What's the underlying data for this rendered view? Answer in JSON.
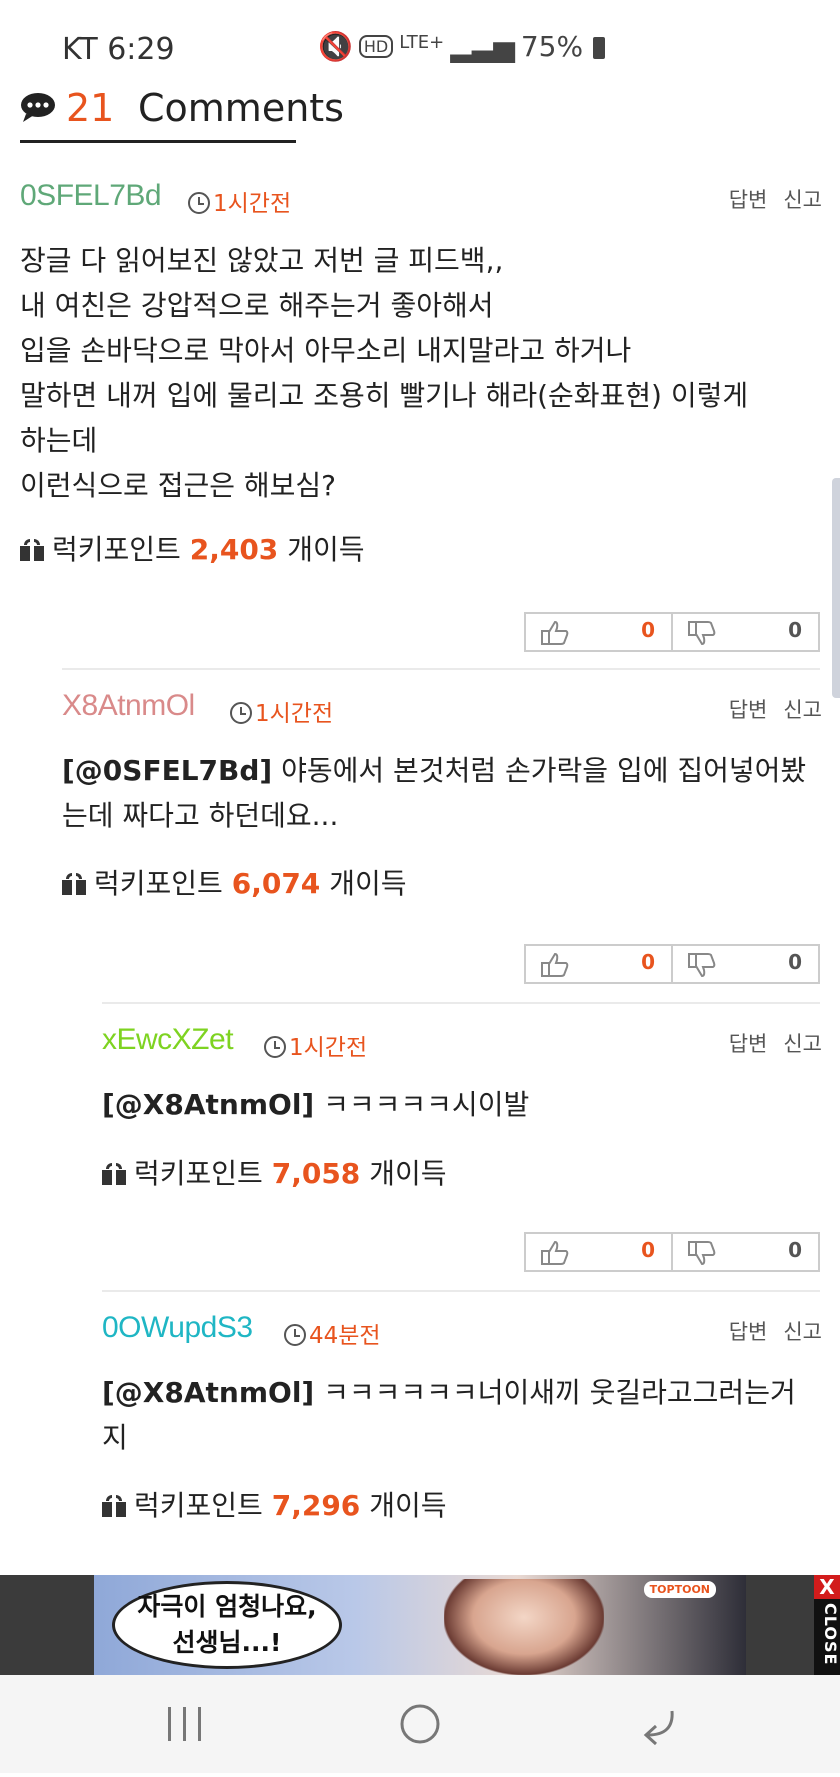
{
  "status_bar": {
    "carrier_time": "KT 6:29",
    "signal_text": "LTE+",
    "battery": "75%"
  },
  "header": {
    "count": "21",
    "label": "Comments"
  },
  "actions": {
    "reply": "답변",
    "report": "신고"
  },
  "lucky_point_label": "럭키포인트",
  "lucky_point_suffix": "개이득",
  "comments": [
    {
      "user": "0SFEL7Bd",
      "user_color": "#5fa878",
      "time": "1시간전",
      "body": "장글 다 읽어보진 않았고 저번 글 피드백,,\n내 여친은 강압적으로 해주는거 좋아해서\n입을 손바닥으로 막아서 아무소리 내지말라고 하거나\n말하면 내꺼 입에 물리고 조용히 빨기나 해라(순화표현) 이렇게\n하는데\n이런식으로 접근은 해보심?",
      "lucky_points": "2,403",
      "likes": "0",
      "dislikes": "0"
    },
    {
      "user": "X8AtnmOl",
      "user_color": "#d98a8a",
      "time": "1시간전",
      "mention": "[@0SFEL7Bd]",
      "body": " 야동에서 본것처럼 손가락을 입에 집어넣어봤\n는데 짜다고 하던데요...",
      "lucky_points": "6,074",
      "likes": "0",
      "dislikes": "0"
    },
    {
      "user": "xEwcXZet",
      "user_color": "#7ed321",
      "time": "1시간전",
      "mention": "[@X8AtnmOl]",
      "body": " ㅋㅋㅋㅋㅋ시이발",
      "lucky_points": "7,058",
      "likes": "0",
      "dislikes": "0"
    },
    {
      "user": "0OWupdS3",
      "user_color": "#1fb6c4",
      "time": "44분전",
      "mention": "[@X8AtnmOl]",
      "body": " ㅋㅋㅋㅋㅋㅋ너이새끼 웃길라고그러는거\n지",
      "lucky_points": "7,296"
    }
  ],
  "ad": {
    "text": "자극이 엄청나요,\n선생님...!",
    "logo": "TOPTOON",
    "close_x": "X",
    "close_label": "CLOSE"
  },
  "colors": {
    "accent": "#e8541e"
  }
}
